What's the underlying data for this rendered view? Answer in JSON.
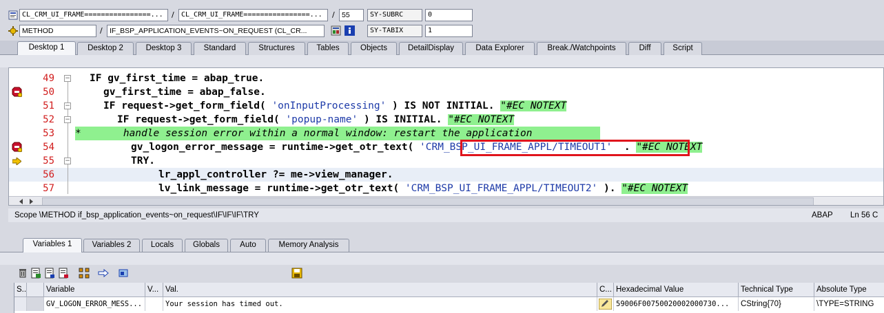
{
  "header": {
    "program": "CL_CRM_UI_FRAME================...",
    "include": "CL_CRM_UI_FRAME================...",
    "line": "55",
    "subrc_label": "SY-SUBRC",
    "subrc_value": "0",
    "event_type": "METHOD",
    "event_name": "IF_BSP_APPLICATION_EVENTS~ON_REQUEST (CL_CR...",
    "tabix_label": "SY-TABIX",
    "tabix_value": "1"
  },
  "desktop_tabs": [
    "Desktop 1",
    "Desktop 2",
    "Desktop 3",
    "Standard",
    "Structures",
    "Tables",
    "Objects",
    "DetailDisplay",
    "Data Explorer",
    "Break./Watchpoints",
    "Diff",
    "Script"
  ],
  "code_lines": [
    {
      "no": "49",
      "text": "IF gv_first_time = abap_true."
    },
    {
      "no": "50",
      "text": "gv_first_time = abap_false."
    },
    {
      "no": "51",
      "text": "IF request->get_form_field( 'onInputProcessing' ) IS NOT INITIAL. \"#EC NOTEXT"
    },
    {
      "no": "52",
      "text": "IF request->get_form_field( 'popup-name' ) IS INITIAL. \"#EC NOTEXT"
    },
    {
      "no": "53",
      "text": "*       handle session error within a normal window: restart the application"
    },
    {
      "no": "54",
      "text": "gv_logon_error_message = runtime->get_otr_text( 'CRM_BSP_UI_FRAME_APPL/TIMEOUT1' ) . \"#EC NOTEXT"
    },
    {
      "no": "55",
      "text": "TRY."
    },
    {
      "no": "56",
      "text": "lr_appl_controller ?= me->view_manager."
    },
    {
      "no": "57",
      "text": "lv_link_message = runtime->get_otr_text( 'CRM_BSP_UI_FRAME_APPL/TIMEOUT2' ). \"#EC NOTEXT"
    }
  ],
  "tokens": {
    "l49_kw": "IF",
    "l49_rest": " gv_first_time = abap_true.",
    "l50": "gv_first_time = abap_false.",
    "l51_kw1": "IF",
    "l51_a": " request->get_form_field( ",
    "l51_str": "'onInputProcessing'",
    "l51_b": " ) ",
    "l51_kw2": "IS NOT INITIAL.",
    "l51_sp": " ",
    "l51_cmt": "\"#EC NOTEXT",
    "l52_kw1": "IF",
    "l52_a": " request->get_form_field( ",
    "l52_str": "'popup-name'",
    "l52_b": " ) ",
    "l52_kw2": "IS INITIAL.",
    "l52_sp": " ",
    "l52_cmt": "\"#EC NOTEXT",
    "l53": "*       handle session error within a normal window: restart the application",
    "l54_a": "gv_logon_error_message = runtime->get_otr_text( ",
    "l54_str": "'CRM_BSP_UI_FRAME_APPL/TIMEOUT1'",
    "l54_b": "  . ",
    "l54_cmt": "\"#EC NOTEXT",
    "l55": "TRY.",
    "l56": "lr_appl_controller ?= me->view_manager.",
    "l57_a": "lv_link_message = runtime->get_otr_text( ",
    "l57_str": "'CRM_BSP_UI_FRAME_APPL/TIMEOUT2'",
    "l57_b": " ). ",
    "l57_cmt": "\"#EC NOTEXT"
  },
  "status": {
    "scope": "Scope \\METHOD if_bsp_application_events~on_request\\IF\\IF\\IF\\TRY",
    "language": "ABAP",
    "position": "Ln  56 C"
  },
  "variable_tabs": [
    "Variables 1",
    "Variables 2",
    "Locals",
    "Globals",
    "Auto",
    "Memory Analysis"
  ],
  "grid": {
    "headers": [
      "S...",
      "Variable",
      "V...",
      "Val.",
      "C...",
      "Hexadecimal Value",
      "Technical Type",
      "Absolute Type"
    ],
    "rows": [
      {
        "variable": "GV_LOGON_ERROR_MESS...",
        "value": "Your session has timed out.",
        "hex": "59006F00750020002000730...",
        "tech_type": "CString{70}",
        "abs_type": "\\TYPE=STRING"
      }
    ]
  }
}
